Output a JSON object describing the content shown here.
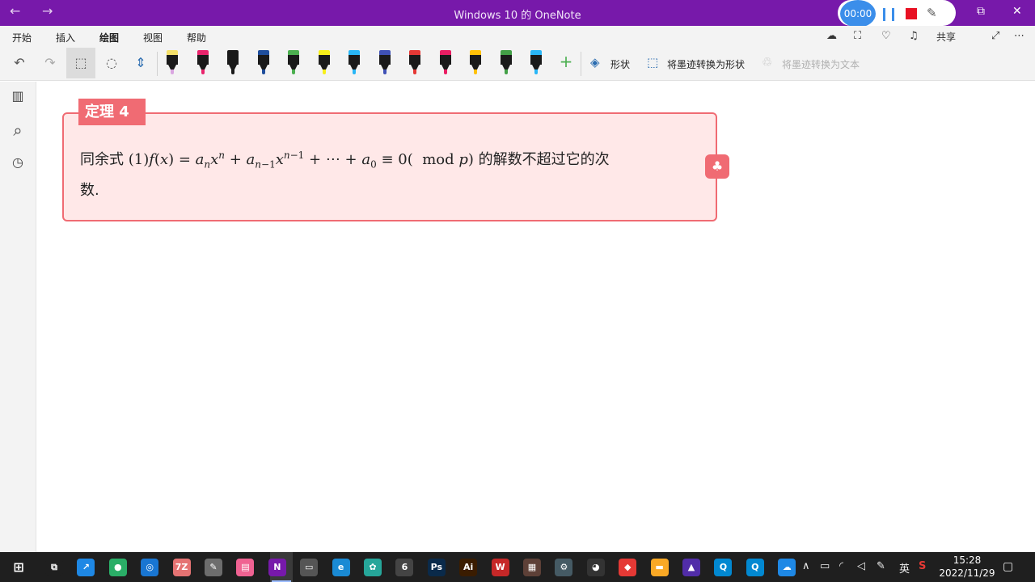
{
  "window": {
    "title": "Windows 10 的 OneNote",
    "back_icon": "←",
    "forward_icon": "→",
    "restore_icon": "⧉",
    "close_icon": "✕"
  },
  "recorder": {
    "timer": "00:00"
  },
  "menu": {
    "tabs": [
      "开始",
      "插入",
      "绘图",
      "视图",
      "帮助"
    ],
    "active_tab": "绘图",
    "share_label": "共享"
  },
  "toolbar": {
    "undo_icon": "↶",
    "redo_icon": "↷",
    "select_icon": "⬚",
    "lasso_icon": "◌",
    "space_icon": "⇕",
    "add_pen_icon": "+",
    "shapes_label": "形状",
    "ink_to_shape_label": "将墨迹转换为形状",
    "ink_to_text_label": "将墨迹转换为文本",
    "pens": [
      {
        "band": "#f4e06a",
        "tip": "#d9a6e0"
      },
      {
        "band": "#e8246c",
        "tip": "#e8246c"
      },
      {
        "band": "#1a1a1a",
        "tip": "#1a1a1a"
      },
      {
        "band": "#1f4e9c",
        "tip": "#1f4e9c"
      },
      {
        "band": "#4caf50",
        "tip": "#4caf50"
      },
      {
        "band": "#f7ef1a",
        "tip": "#f7ef1a"
      },
      {
        "band": "#29b6f6",
        "tip": "#29b6f6"
      },
      {
        "band": "#3f51b5",
        "tip": "#3f51b5"
      },
      {
        "band": "#e53935",
        "tip": "#e53935"
      },
      {
        "band": "#e91e63",
        "tip": "#e91e63"
      },
      {
        "band": "#ffc107",
        "tip": "#ffc107"
      },
      {
        "band": "#43a047",
        "tip": "#43a047"
      },
      {
        "band": "#29b6f6",
        "tip": "#29b6f6"
      }
    ]
  },
  "rail": {
    "notebooks_icon": "▥",
    "search_icon": "⌕",
    "recent_icon": "◷"
  },
  "theorem": {
    "label": "定理 4",
    "text_prefix": "同余式 ",
    "text_suffix": " 的解数不超过它的次",
    "text_line2": "数.",
    "badge_icon": "♣"
  },
  "taskbar": {
    "time": "15:28",
    "date": "2022/11/29",
    "ime": "英",
    "apps": [
      {
        "name": "task-view",
        "label": "⧉",
        "color": "#1f1f1f"
      },
      {
        "name": "app-blue",
        "label": "↗",
        "color": "#1e88e5"
      },
      {
        "name": "wechat",
        "label": "●",
        "color": "#2aae67"
      },
      {
        "name": "app-circle",
        "label": "◎",
        "color": "#1976d2"
      },
      {
        "name": "app-7z",
        "label": "7Z",
        "color": "#e57373"
      },
      {
        "name": "app-paint",
        "label": "✎",
        "color": "#6d6d6d"
      },
      {
        "name": "app-pink",
        "label": "▤",
        "color": "#f06292"
      },
      {
        "name": "onenote",
        "label": "N",
        "color": "#7719aa"
      },
      {
        "name": "app-monitor",
        "label": "▭",
        "color": "#555555"
      },
      {
        "name": "edge",
        "label": "e",
        "color": "#1a8ad4"
      },
      {
        "name": "app-flower",
        "label": "✿",
        "color": "#26a69a"
      },
      {
        "name": "app-6",
        "label": "6",
        "color": "#444444"
      },
      {
        "name": "photoshop",
        "label": "Ps",
        "color": "#0a2a4a"
      },
      {
        "name": "illustrator",
        "label": "Ai",
        "color": "#3a1c00"
      },
      {
        "name": "wps",
        "label": "W",
        "color": "#c62828"
      },
      {
        "name": "app-film",
        "label": "▦",
        "color": "#5d4037"
      },
      {
        "name": "app-gear",
        "label": "⚙",
        "color": "#455a64"
      },
      {
        "name": "qq",
        "label": "◕",
        "color": "#333333"
      },
      {
        "name": "app-color",
        "label": "◆",
        "color": "#e53935"
      },
      {
        "name": "explorer",
        "label": "▬",
        "color": "#f9a825"
      },
      {
        "name": "app-purple",
        "label": "▲",
        "color": "#512da8"
      },
      {
        "name": "app-q1",
        "label": "Q",
        "color": "#0288d1"
      },
      {
        "name": "app-q2",
        "label": "Q",
        "color": "#0288d1"
      },
      {
        "name": "app-cloud",
        "label": "☁",
        "color": "#1e88e5"
      }
    ]
  }
}
